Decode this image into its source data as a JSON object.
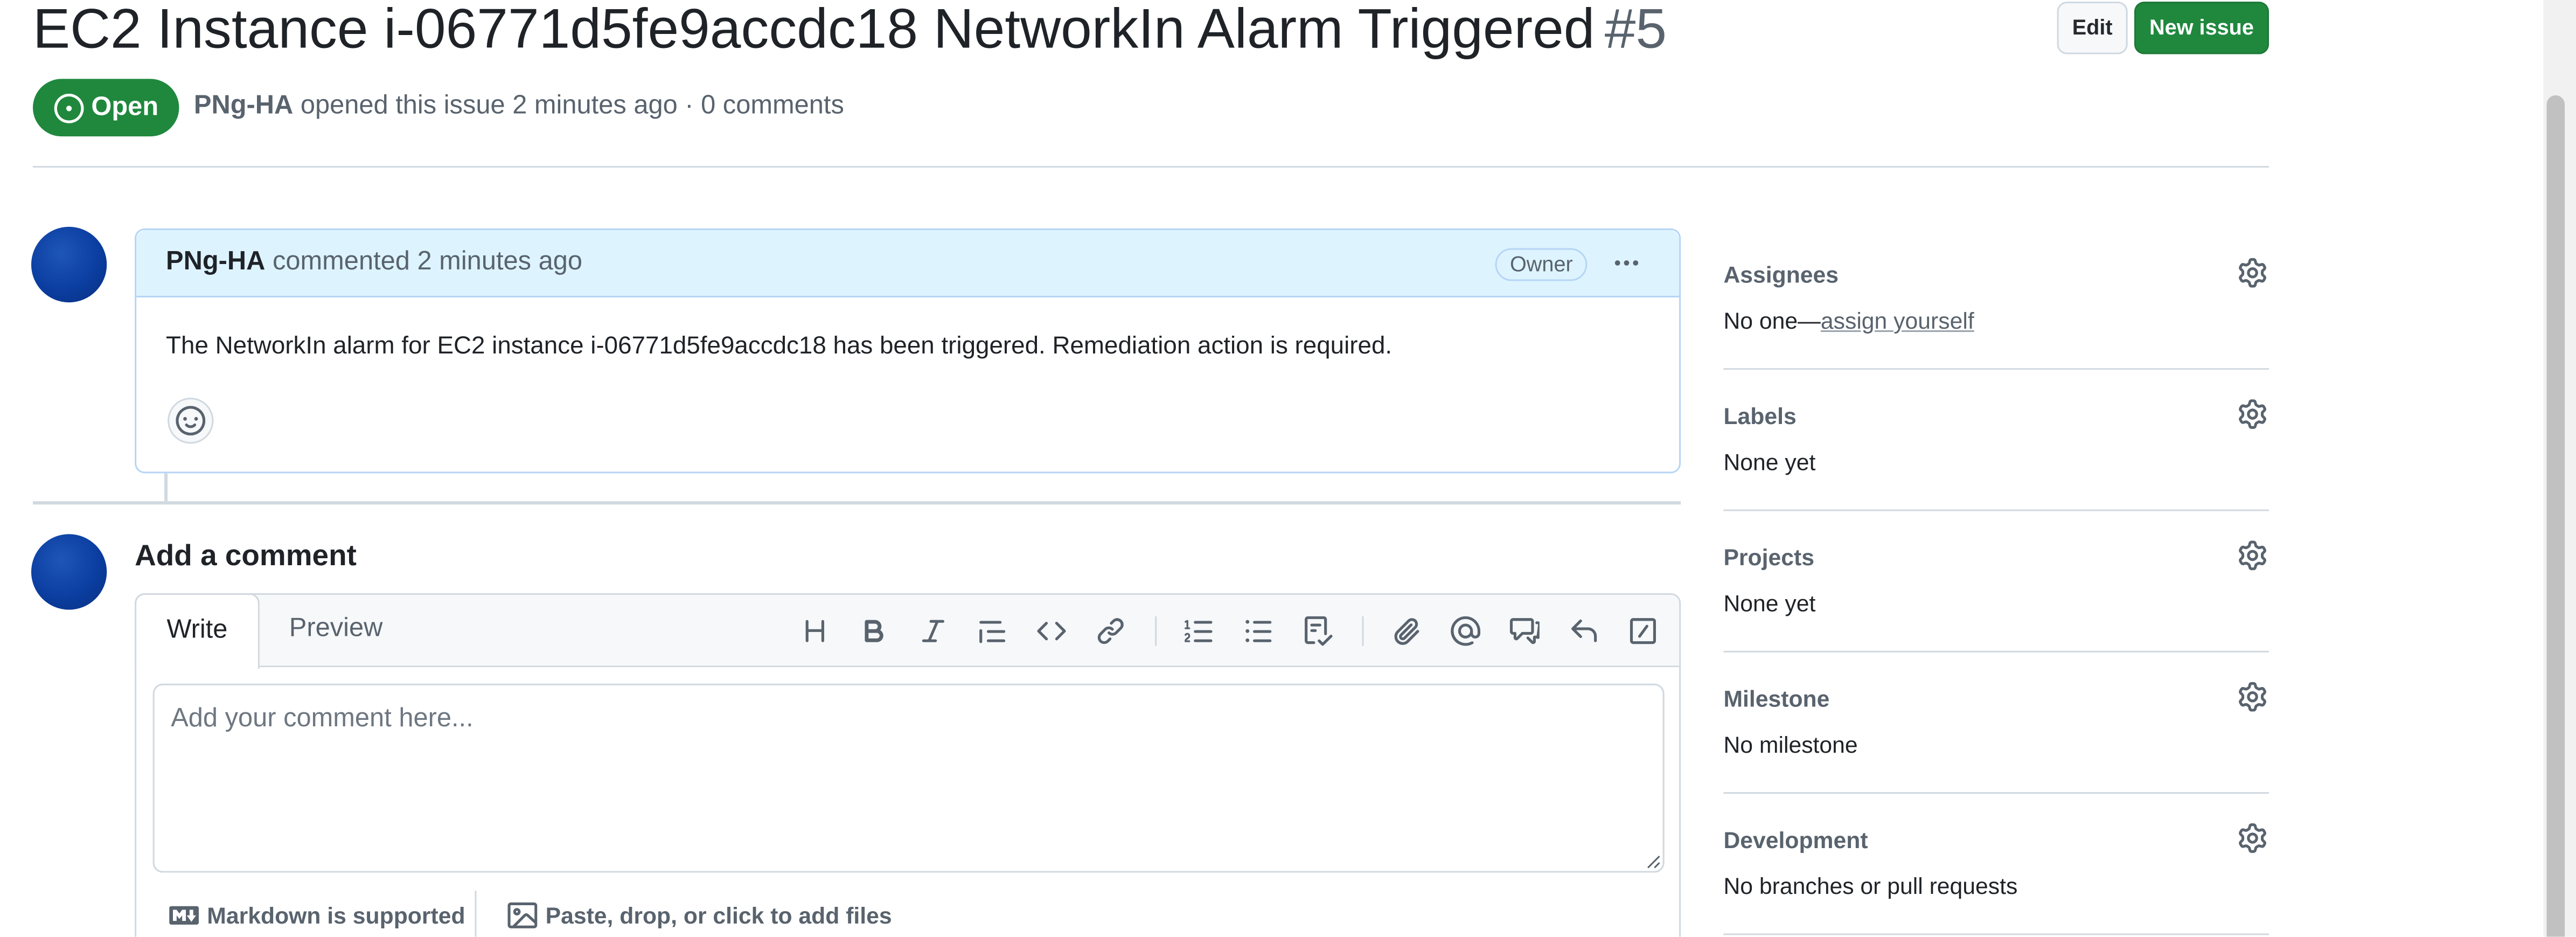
{
  "issue": {
    "title": "EC2 Instance i-06771d5fe9accdc18 NetworkIn Alarm Triggered",
    "number": "#5",
    "state": "Open",
    "author": "PNg-HA",
    "meta": "opened this issue 2 minutes ago · 0 comments"
  },
  "header": {
    "edit_label": "Edit",
    "new_issue_label": "New issue",
    "new_issue_color": "#1f883d"
  },
  "comment": {
    "author": "PNg-HA",
    "meta": "commented 2 minutes ago",
    "badge": "Owner",
    "body": "The NetworkIn alarm for EC2 instance i-06771d5fe9accdc18 has been triggered. Remediation action is required.",
    "header_color": "#ddf4ff"
  },
  "composer": {
    "heading": "Add a comment",
    "tabs": [
      "Write",
      "Preview"
    ],
    "placeholder": "Add your comment here...",
    "toolbar_icons": [
      "heading-icon",
      "bold-icon",
      "italic-icon",
      "quote-icon",
      "code-icon",
      "link-icon",
      "numbered-list-icon",
      "unordered-list-icon",
      "task-list-icon",
      "attach-icon",
      "mention-icon",
      "cross-reference-icon",
      "reply-icon",
      "slash-commands-icon"
    ],
    "markdown_note": "Markdown is supported",
    "attach_note": "Paste, drop, or click to add files"
  },
  "sidebar": {
    "sections": [
      {
        "heading": "Assignees",
        "value": "No one—",
        "link": "assign yourself"
      },
      {
        "heading": "Labels",
        "value": "None yet"
      },
      {
        "heading": "Projects",
        "value": "None yet"
      },
      {
        "heading": "Milestone",
        "value": "No milestone"
      },
      {
        "heading": "Development",
        "value": "No branches or pull requests"
      }
    ]
  }
}
